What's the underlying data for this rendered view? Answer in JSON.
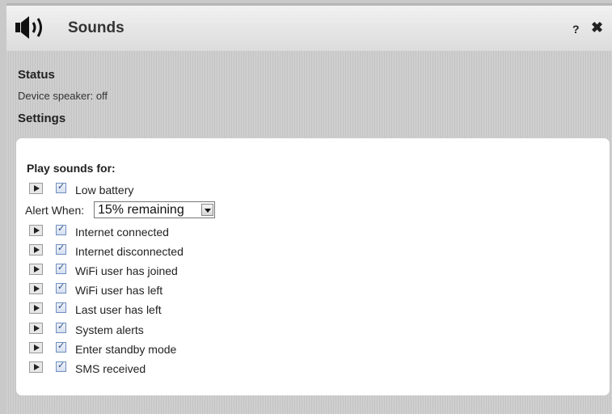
{
  "window": {
    "title": "Sounds",
    "help_label": "?",
    "close_label": "✖"
  },
  "status": {
    "heading": "Status",
    "device_speaker": "Device speaker: off"
  },
  "settings": {
    "heading": "Settings",
    "play_sounds_label": "Play sounds for:",
    "alert_when_label": "Alert When:",
    "alert_when_value": "15% remaining",
    "items": [
      {
        "label": "Low battery",
        "checked": true
      },
      {
        "label": "Internet connected",
        "checked": true
      },
      {
        "label": "Internet disconnected",
        "checked": true
      },
      {
        "label": "WiFi user has joined",
        "checked": true
      },
      {
        "label": "WiFi user has left",
        "checked": true
      },
      {
        "label": "Last user has left",
        "checked": true
      },
      {
        "label": "System alerts",
        "checked": true
      },
      {
        "label": "Enter standby mode",
        "checked": true
      },
      {
        "label": "SMS received",
        "checked": true
      }
    ]
  }
}
